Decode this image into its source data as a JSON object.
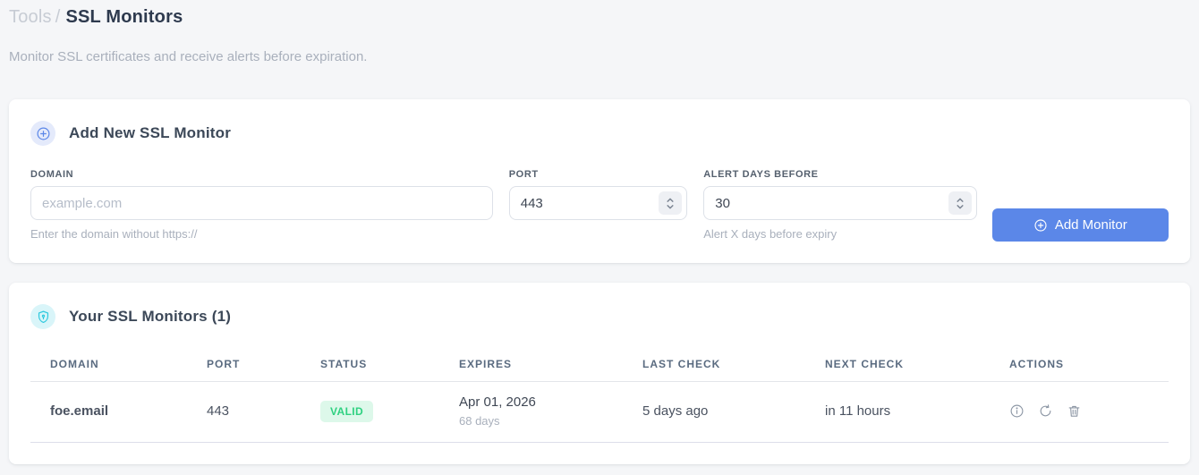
{
  "breadcrumb": {
    "section": "Tools",
    "separator": "/",
    "current": "SSL Monitors"
  },
  "subtitle": "Monitor SSL certificates and receive alerts before expiration.",
  "add_card": {
    "title": "Add New SSL Monitor",
    "icon": "plus-circle-icon",
    "fields": {
      "domain": {
        "label": "DOMAIN",
        "placeholder": "example.com",
        "value": "",
        "helper": "Enter the domain without https://"
      },
      "port": {
        "label": "PORT",
        "value": "443"
      },
      "alert_days": {
        "label": "ALERT DAYS BEFORE",
        "value": "30",
        "helper": "Alert X days before expiry"
      }
    },
    "submit_label": "Add Monitor"
  },
  "monitors_card": {
    "title": "Your SSL Monitors (1)",
    "icon": "shield-icon",
    "count": 1,
    "table": {
      "headers": [
        "DOMAIN",
        "PORT",
        "STATUS",
        "EXPIRES",
        "LAST CHECK",
        "NEXT CHECK",
        "ACTIONS"
      ],
      "rows": [
        {
          "domain": "foe.email",
          "port": "443",
          "status": "VALID",
          "expires_date": "Apr 01, 2026",
          "expires_days": "68 days",
          "last_check": "5 days ago",
          "next_check": "in 11 hours",
          "actions": [
            "info-icon",
            "refresh-icon",
            "trash-icon"
          ]
        }
      ]
    }
  },
  "colors": {
    "accent_blue": "#5b87e8",
    "valid_green": "#2fd181",
    "valid_green_bg": "#ddf8ea",
    "shield_cyan": "#2fc9de",
    "next_check_blue": "#5b8cf0"
  }
}
